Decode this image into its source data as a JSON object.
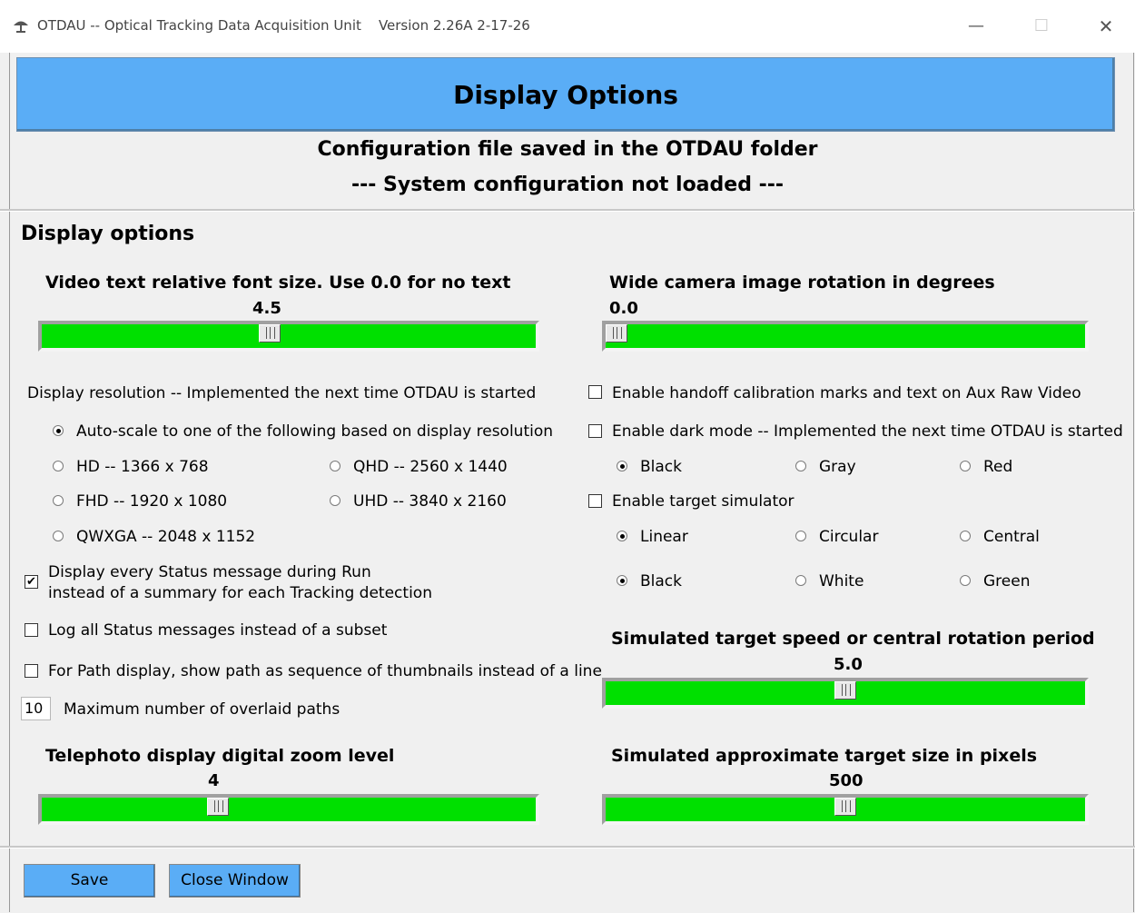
{
  "window": {
    "title": "OTDAU -- Optical Tracking Data Acquisition Unit    Version 2.26A 2-17-26",
    "minimize_glyph": "—",
    "maximize_glyph": "☐",
    "close_glyph": "✕",
    "app_icon": "satellite-dish-icon"
  },
  "header": {
    "title": "Display Options",
    "config_note": "Configuration file saved in the OTDAU folder",
    "system_note": "--- System configuration not loaded ---"
  },
  "section_title": "Display options",
  "left": {
    "font_slider": {
      "label": "Video text relative font size. Use 0.0 for no text",
      "value_text": "4.5",
      "fraction": 0.46
    },
    "resolution_title": "Display resolution -- Implemented the next time OTDAU is started",
    "resolution_options": [
      {
        "label": "Auto-scale to one of the following based on display resolution",
        "selected": true
      },
      {
        "label": "HD -- 1366 x 768",
        "selected": false
      },
      {
        "label": "QHD -- 2560 x 1440",
        "selected": false
      },
      {
        "label": "FHD -- 1920 x 1080",
        "selected": false
      },
      {
        "label": "UHD -- 3840 x 2160",
        "selected": false
      },
      {
        "label": "QWXGA -- 2048 x 1152",
        "selected": false
      }
    ],
    "status_every": {
      "line1": "Display every Status message during Run",
      "line2": "instead of a summary for each Tracking detection",
      "checked": true,
      "check_glyph": "✔"
    },
    "log_all": {
      "label": "Log all Status messages instead of a subset",
      "checked": false
    },
    "path_thumbs": {
      "label": "For Path display, show path as sequence of thumbnails instead of a line",
      "checked": false
    },
    "max_paths": {
      "value": "10",
      "label": "Maximum number of overlaid paths"
    },
    "zoom_slider": {
      "label": "Telephoto display digital zoom level",
      "value_text": "4",
      "fraction": 0.35
    }
  },
  "right": {
    "rotation_slider": {
      "label": "Wide camera image rotation in degrees",
      "value_text": "0.0",
      "fraction": 0.0
    },
    "handoff": {
      "label": "Enable handoff calibration marks and text on Aux Raw Video",
      "checked": false
    },
    "dark_mode": {
      "label": "Enable dark mode -- Implemented the next time OTDAU is started",
      "checked": false
    },
    "dark_colors": [
      {
        "label": "Black",
        "selected": true
      },
      {
        "label": "Gray",
        "selected": false
      },
      {
        "label": "Red",
        "selected": false
      }
    ],
    "target_sim": {
      "label": "Enable target simulator",
      "checked": false
    },
    "motion_types": [
      {
        "label": "Linear",
        "selected": true
      },
      {
        "label": "Circular",
        "selected": false
      },
      {
        "label": "Central",
        "selected": false
      }
    ],
    "target_colors": [
      {
        "label": "Black",
        "selected": true
      },
      {
        "label": "White",
        "selected": false
      },
      {
        "label": "Green",
        "selected": false
      }
    ],
    "speed_slider": {
      "label": "Simulated target speed or central rotation period",
      "value_text": "5.0",
      "fraction": 0.5
    },
    "size_slider": {
      "label": "Simulated approximate target size in pixels",
      "value_text": "500",
      "fraction": 0.5
    }
  },
  "footer": {
    "save_label": "Save",
    "close_label": "Close Window"
  },
  "colors": {
    "banner": "#5aadf6",
    "slider_fill": "#00e000",
    "button": "#5aadf6"
  }
}
